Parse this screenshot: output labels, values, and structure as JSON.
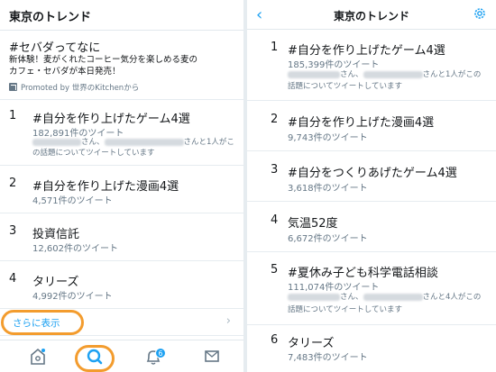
{
  "left": {
    "title": "東京のトレンド",
    "promo": {
      "title": "#セバダってなに",
      "desc_line1": "新体験！麦がくれたコーヒー気分を楽しめる麦の",
      "desc_line2": "カフェ・セバダが本日発売！",
      "by": "Promoted by 世界のKitchenから"
    },
    "trends": [
      {
        "rank": "1",
        "topic": "#自分を作り上げたゲーム4選",
        "count": "182,891件のツイート",
        "ctx_a": "さん、",
        "ctx_b": "さんと1人がこ",
        "ctx_line2": "の話題についてツイートしています"
      },
      {
        "rank": "2",
        "topic": "#自分を作り上げた漫画4選",
        "count": "4,571件のツイート"
      },
      {
        "rank": "3",
        "topic": "投資信託",
        "count": "12,602件のツイート"
      },
      {
        "rank": "4",
        "topic": "タリーズ",
        "count": "4,992件のツイート"
      }
    ],
    "show_more": "さらに表示",
    "tabs": {
      "notification_badge": "6"
    }
  },
  "right": {
    "title": "東京のトレンド",
    "trends": [
      {
        "rank": "1",
        "topic": "#自分を作り上げたゲーム4選",
        "count": "185,399件のツイート",
        "ctx_a": "さん、",
        "ctx_b": "さんと1人がこの",
        "ctx_line2": "話題についてツイートしています"
      },
      {
        "rank": "2",
        "topic": "#自分を作り上げた漫画4選",
        "count": "9,743件のツイート"
      },
      {
        "rank": "3",
        "topic": "#自分をつくりあげたゲーム4選",
        "count": "3,618件のツイート"
      },
      {
        "rank": "4",
        "topic": "気温52度",
        "count": "6,672件のツイート"
      },
      {
        "rank": "5",
        "topic": "#夏休み子ども科学電話相談",
        "count": "111,074件のツイート",
        "ctx_a": "さん、",
        "ctx_b": "さんと4人がこの",
        "ctx_line2": "話題についてツイートしています"
      },
      {
        "rank": "6",
        "topic": "タリーズ",
        "count": "7,483件のツイート"
      }
    ]
  },
  "colors": {
    "accent": "#1da1f2",
    "highlight": "#f39c2e"
  }
}
